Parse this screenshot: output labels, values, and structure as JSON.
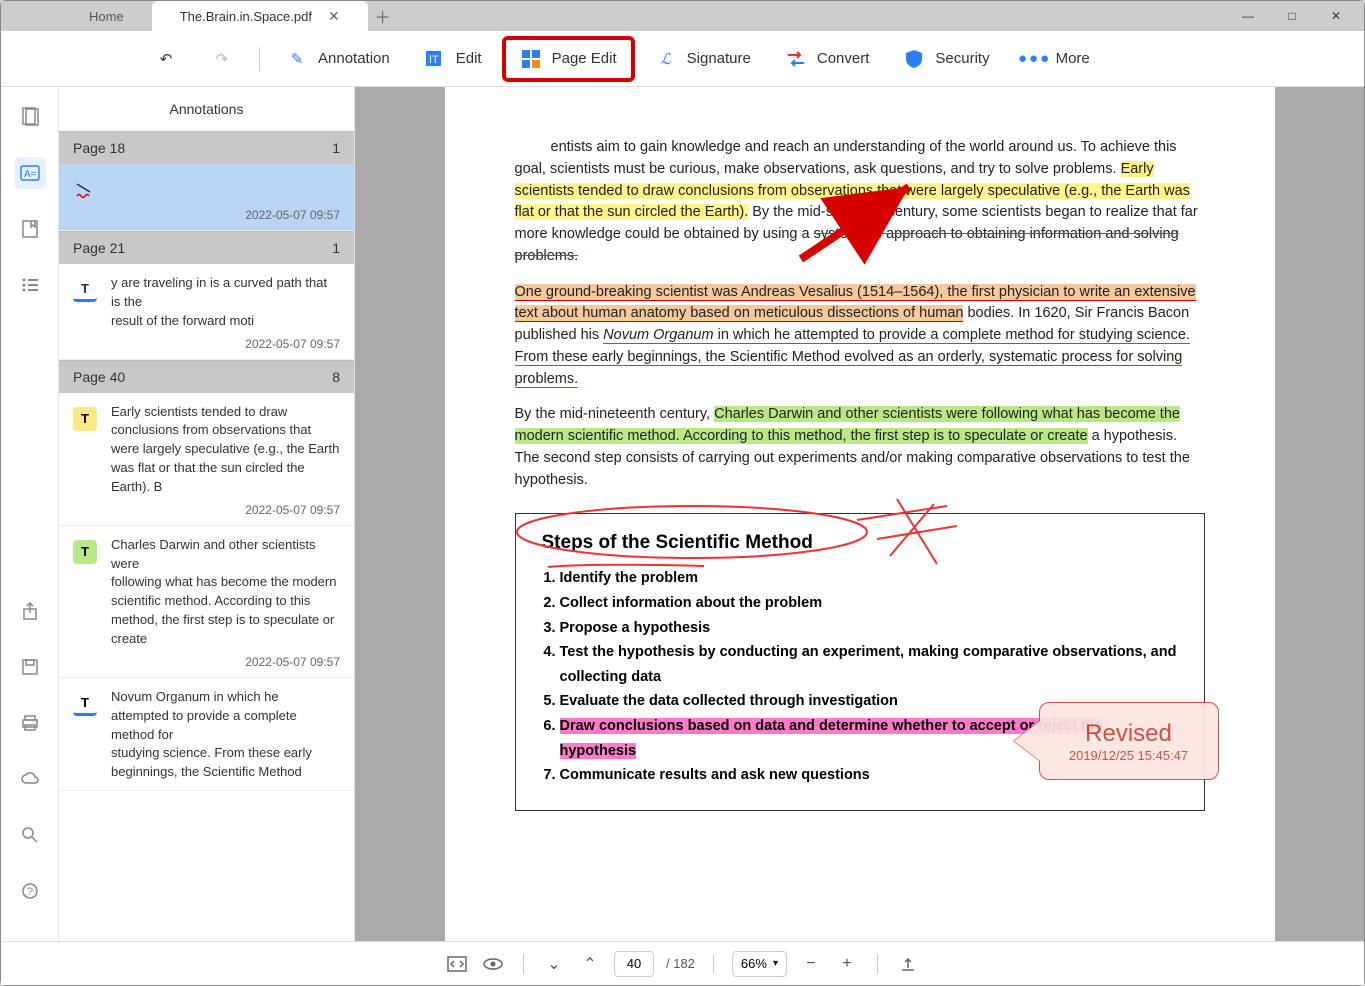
{
  "tabs": {
    "home": "Home",
    "doc": "The.Brain.in.Space.pdf"
  },
  "toolbar": {
    "annotation": "Annotation",
    "edit": "Edit",
    "pageedit": "Page Edit",
    "signature": "Signature",
    "convert": "Convert",
    "security": "Security",
    "more": "More"
  },
  "panel": {
    "title": "Annotations",
    "pages": [
      {
        "label": "Page 18",
        "count": "1",
        "items": [
          {
            "type": "squiggle",
            "text": "",
            "date": "2022-05-07 09:57",
            "selected": true
          }
        ]
      },
      {
        "label": "Page 21",
        "count": "1",
        "items": [
          {
            "type": "ul-blue",
            "text": "y are traveling in is a curved path that is the\nresult of the forward moti",
            "date": "2022-05-07 09:57"
          }
        ]
      },
      {
        "label": "Page 40",
        "count": "8",
        "items": [
          {
            "type": "hl-yellow",
            "text": " Early scientists tended to draw conclusions from observations that were largely speculative (e.g., the Earth was flat or that the sun circled the Earth). B",
            "date": "2022-05-07 09:57"
          },
          {
            "type": "hl-green",
            "text": " Charles Darwin and other scientists were\nfollowing what has become the modern scientific method. According to this\nmethod, the first step is to speculate or create",
            "date": "2022-05-07 09:57"
          },
          {
            "type": "ul-blue",
            "text": "Novum Organum in which he attempted to provide a complete method for\nstudying science. From these early beginnings, the Scientific Method",
            "date": ""
          }
        ]
      }
    ]
  },
  "doc": {
    "p1_a": "entists aim to gain knowledge and reach an understanding of the world around us. To achieve this goal, scientists must be curious, make observa­tions, ask questions, and try to solve problems. ",
    "p1_hl": "Early scientists tended to draw conclusions from observations that were largely speculative (e.g., the Earth was flat or that the sun circled the Earth).",
    "p1_b": " By the mid-sixteenth centu­ry, some scientists began to realize that far more knowledge could be obtained by using a ",
    "p1_s": "systematic approach to obtaining information and solv­ing problems.",
    "p2_hl": "One ground-breaking scientist was Andreas Vesalius (1514–1564), the first physician to write an extensive text about human anatomy based on metic­ulous dissections of human",
    "p2_b": " bodies. In 1620, Sir Francis Bacon published his ",
    "p2_i": "Novum Organum",
    "p2_c": " in which he attempted to provide a complete method for studying science. From these early beginnings, the Scientific Method evolved as an orderly, systematic process for solving problems.",
    "p3_a": "By the mid-nineteenth century, ",
    "p3_hl": "Charles Darwin and other scientists were following what has become the modern scientific method. According to this method, the first step is to speculate or create",
    "p3_b": " a hypothesis. The second step consists of carrying out experiments and/or making comparative observa­tions to test the hypothesis.",
    "box_title": "Steps of the Scientific Method",
    "steps": [
      "Identify the problem",
      "Collect information about the problem",
      "Propose a hypothesis",
      "Test the hypothesis by conducting an experiment, making comparative observations, and collecting data",
      "Evaluate the data collected through investigation",
      "Draw conclusions based on data and determine whether to accept or reject the hypothesis",
      "Communicate results and ask new questions"
    ]
  },
  "stamp": {
    "label": "Revised",
    "date": "2019/12/25 15:45:47"
  },
  "bottom": {
    "page": "40",
    "total": "/ 182",
    "zoom": "66%",
    "caret": "▾"
  }
}
